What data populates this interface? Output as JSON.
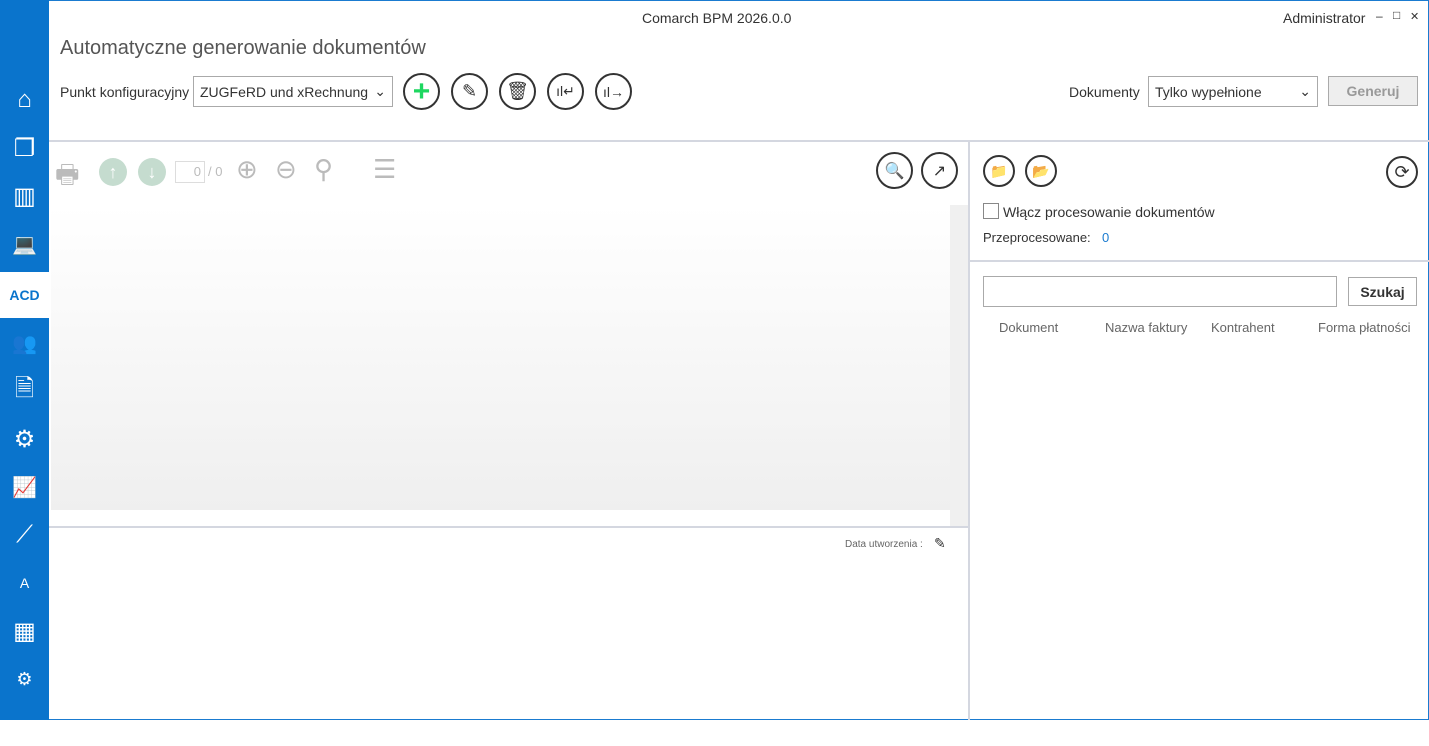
{
  "window": {
    "title": "Comarch BPM 2026.0.0",
    "user": "Administrator",
    "minimize": "–",
    "maximize": "□",
    "close": "✕"
  },
  "sidebar": {
    "items": [
      {
        "name": "home",
        "glyph": "⌂"
      },
      {
        "name": "documents",
        "glyph": "❐"
      },
      {
        "name": "binders",
        "glyph": "▥"
      },
      {
        "name": "workstation",
        "glyph": "💻"
      },
      {
        "name": "acd",
        "glyph": "ACD"
      },
      {
        "name": "users",
        "glyph": "👥"
      },
      {
        "name": "document-sync",
        "glyph": "🗎"
      },
      {
        "name": "settings",
        "glyph": "⚙"
      },
      {
        "name": "reports",
        "glyph": "📈"
      },
      {
        "name": "wizard",
        "glyph": "⟋"
      },
      {
        "name": "template",
        "glyph": "A"
      },
      {
        "name": "calendar",
        "glyph": "▦"
      },
      {
        "name": "user-settings",
        "glyph": "⚙"
      },
      {
        "name": "more",
        "glyph": "▬"
      }
    ]
  },
  "header": {
    "title": "Automatyczne generowanie dokumentów",
    "config_label": "Punkt konfiguracyjny",
    "config_value": "ZUGFeRD und xRechnung",
    "documents_label": "Dokumenty",
    "documents_value": "Tylko wypełnione",
    "generate": "Generuj"
  },
  "viewer": {
    "page_current": "0",
    "page_total": "/ 0",
    "created_label": "Data utworzenia :"
  },
  "right": {
    "enable_processing": "Włącz procesowanie dokumentów",
    "processed_label": "Przeprocesowane:",
    "processed_value": "0",
    "search_value": "",
    "search_button": "Szukaj",
    "columns": [
      "Dokument",
      "Nazwa faktury",
      "Kontrahent",
      "Forma płatności"
    ]
  },
  "colors": {
    "accent": "#0a74cc",
    "add": "#1ed760"
  }
}
